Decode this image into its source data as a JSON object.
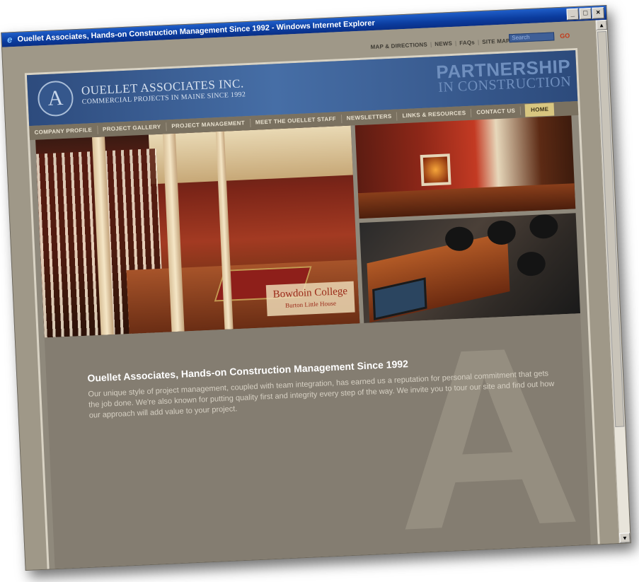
{
  "window": {
    "title": "Ouellet Associates, Hands-on Construction Management Since 1992 - Windows Internet Explorer",
    "controls": [
      "_",
      "□",
      "×"
    ]
  },
  "top_links": [
    "MAP & DIRECTIONS",
    "NEWS",
    "FAQs",
    "SITE MAP"
  ],
  "search": {
    "placeholder": "Search",
    "go_label": "GO"
  },
  "header": {
    "logo_letter": "A",
    "company_name": "OUELLET ASSOCIATES INC.",
    "tagline": "COMMERCIAL PROJECTS IN MAINE SINCE 1992",
    "slogan_line1": "PARTNERSHIP",
    "slogan_line2": "IN CONSTRUCTION"
  },
  "nav": {
    "items": [
      "COMPANY PROFILE",
      "PROJECT GALLERY",
      "PROJECT MANAGEMENT",
      "MEET THE OUELLET STAFF",
      "NEWSLETTERS",
      "LINKS & RESOURCES",
      "CONTACT US"
    ],
    "home": "HOME"
  },
  "photo_caption": {
    "title": "Bowdoin College",
    "subtitle": "Burton Little House"
  },
  "main": {
    "headline": "Ouellet Associates, Hands-on Construction Management Since 1992",
    "body": "Our unique style of project management, coupled with team integration, has earned us a reputation for personal commitment that gets the job done. We're also known for putting quality first and integrity every step of the way. We invite you to tour our site and find out how our approach will add value to your project.",
    "watermark": "A"
  },
  "colors": {
    "header_blue": "#3c5f94",
    "nav_brown": "#7a7160",
    "home_gold": "#d8c680",
    "content_taupe": "#847d71",
    "go_red": "#c33a1a"
  }
}
